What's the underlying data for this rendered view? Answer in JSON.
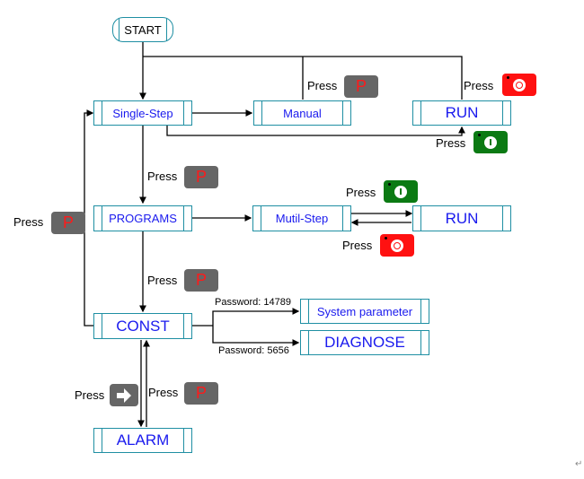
{
  "nodes": {
    "start": "START",
    "single_step": "Single-Step",
    "manual": "Manual",
    "run_top": "RUN",
    "programs": "PROGRAMS",
    "mutil_step": "Mutil-Step",
    "run_mid": "RUN",
    "const": "CONST",
    "system_parameter": "System parameter",
    "diagnose": "DIAGNOSE",
    "alarm": "ALARM"
  },
  "labels": {
    "press": "Press",
    "password_system": "Password: 14789",
    "password_diagnose": "Password: 5656"
  },
  "keys": {
    "p_key": "P",
    "stop_key": "stop-button",
    "start_key": "start-button",
    "arrow_key": "right-arrow-button"
  },
  "colors": {
    "box_border": "#1f8fa3",
    "node_text": "#1a1aee",
    "p_key_bg": "#666666",
    "p_key_text": "#ff1a1a",
    "stop_bg": "#ff1111",
    "start_bg": "#0b7a13"
  },
  "footer": {
    "return_mark": "↵"
  }
}
